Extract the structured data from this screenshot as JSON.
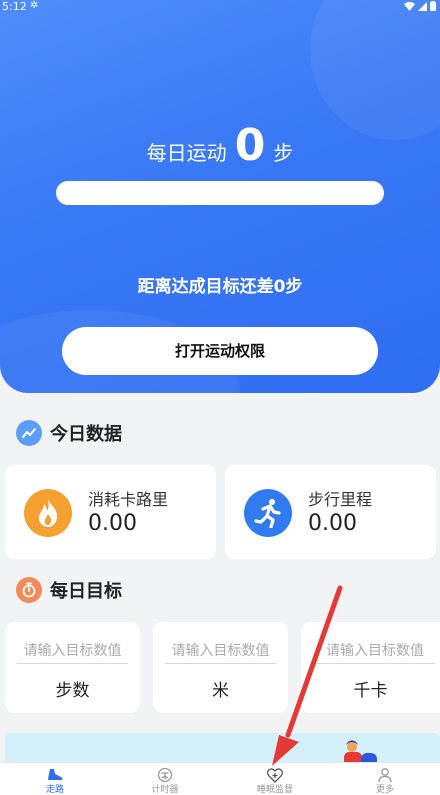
{
  "status_bar": {
    "time": "5:12"
  },
  "hero": {
    "daily_label": "每日运动",
    "steps": "0",
    "steps_unit": "步",
    "progress_fraction": 0,
    "remaining_text": "距离达成目标还差0步",
    "permission_button": "打开运动权限"
  },
  "today": {
    "title": "今日数据",
    "cards": [
      {
        "label": "消耗卡路里",
        "value": "0.00"
      },
      {
        "label": "步行里程",
        "value": "0.00"
      }
    ]
  },
  "goals": {
    "title": "每日目标",
    "placeholder": "请输入目标数值",
    "items": [
      {
        "unit": "步数"
      },
      {
        "unit": "米"
      },
      {
        "unit": "千卡"
      }
    ]
  },
  "tabbar": {
    "tabs": [
      {
        "label": "走路",
        "icon": "shoe-icon",
        "active": true
      },
      {
        "label": "计时器",
        "icon": "timer-icon",
        "active": false
      },
      {
        "label": "睡眠监督",
        "icon": "heart-plus-icon",
        "active": false
      },
      {
        "label": "更多",
        "icon": "person-icon",
        "active": false
      }
    ]
  },
  "colors": {
    "brand_blue": "#2f6ef2",
    "calorie_orange": "#f5a131",
    "arrow_red": "#e53935"
  }
}
